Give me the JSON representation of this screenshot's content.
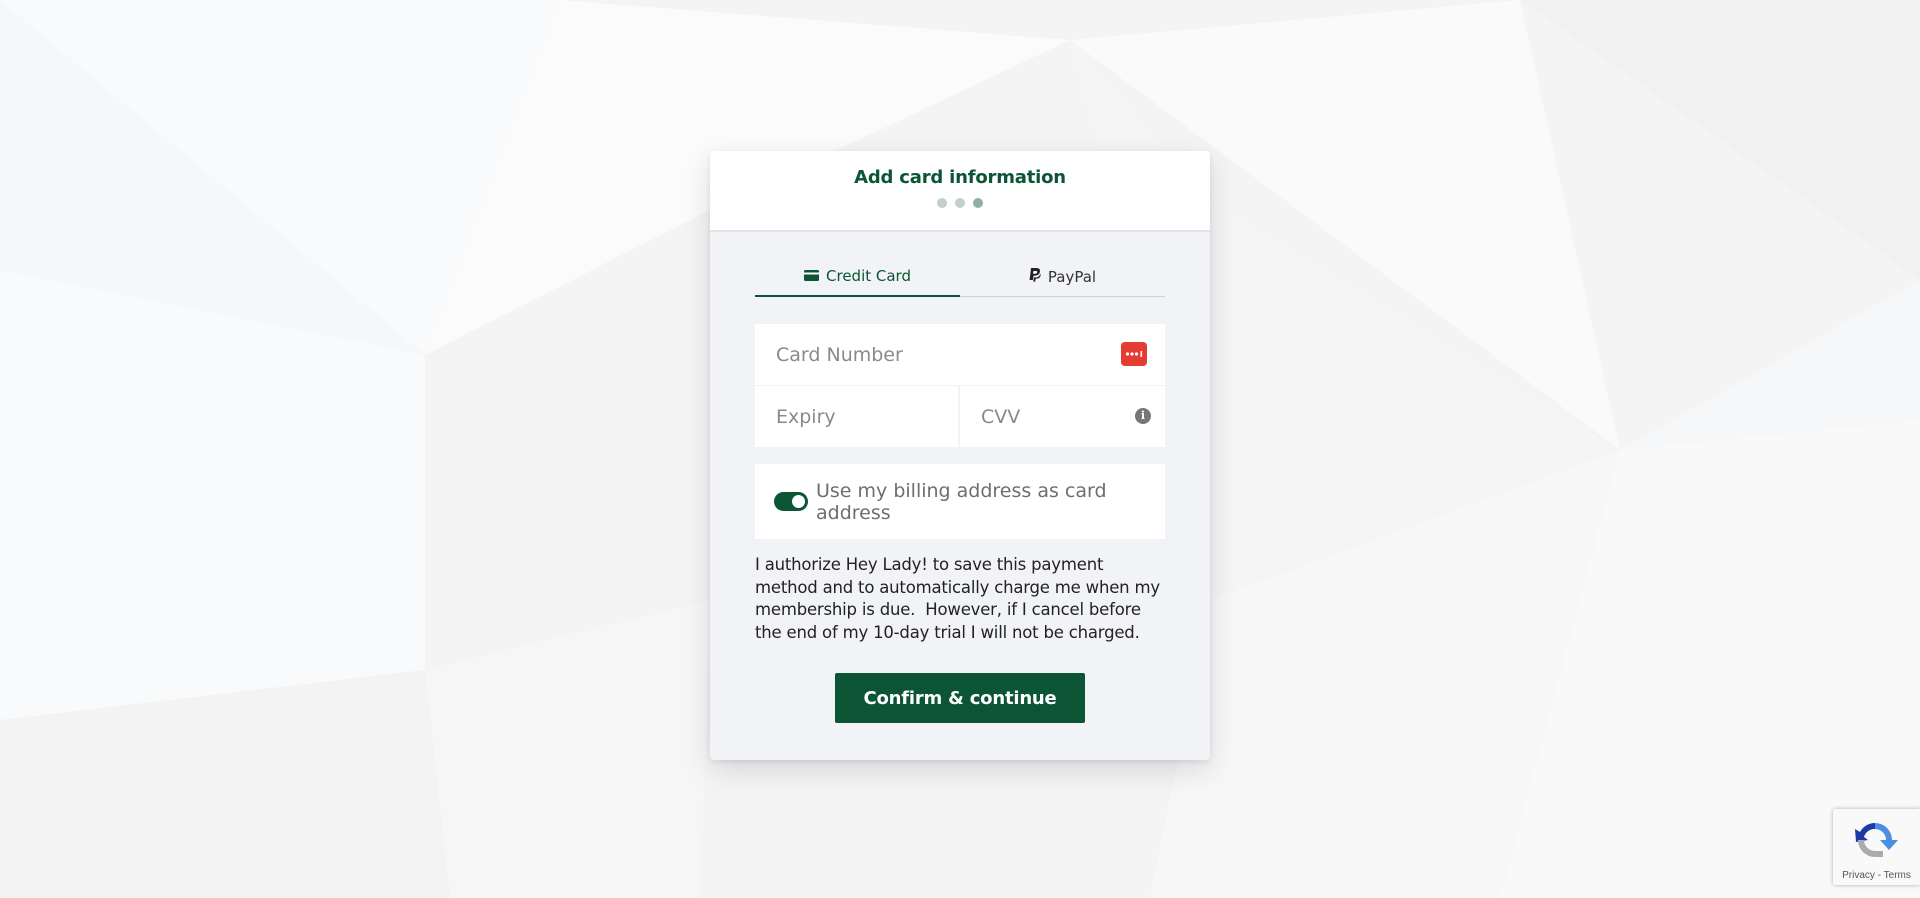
{
  "header": {
    "title": "Add card information",
    "steps_total": 3,
    "current_step": 3
  },
  "tabs": [
    {
      "label": "Credit Card",
      "icon": "credit-card-icon",
      "active": true
    },
    {
      "label": "PayPal",
      "icon": "paypal-icon",
      "active": false
    }
  ],
  "fields": {
    "card_number_placeholder": "Card Number",
    "expiry_placeholder": "Expiry",
    "cvv_placeholder": "CVV"
  },
  "billing_toggle": {
    "label": "Use my billing address as card address",
    "checked": true
  },
  "authorization_text": "I authorize Hey Lady! to save this payment method and to automatically charge me when my membership is due.  However, if I cancel before the end of my 10-day trial I will not be charged.",
  "confirm_button_label": "Confirm & continue",
  "recaptcha": {
    "privacy_label": "Privacy",
    "separator": " - ",
    "terms_label": "Terms"
  },
  "colors": {
    "brand_green": "#0b5535",
    "card_brand_red": "#e43b32"
  }
}
